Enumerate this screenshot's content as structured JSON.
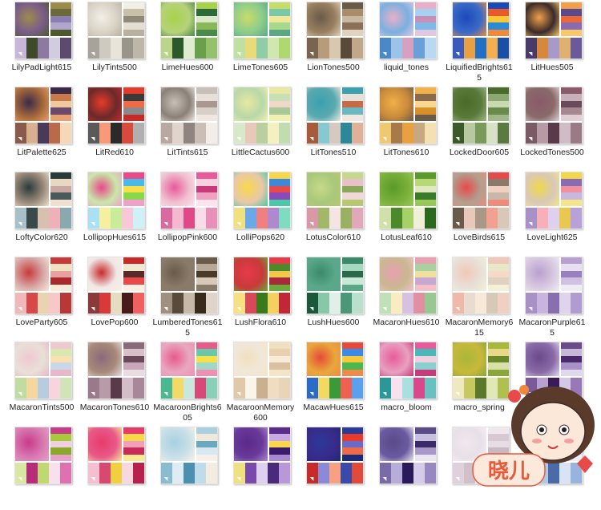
{
  "tiles": [
    {
      "label": "LilyPadLight615",
      "photo": "#7a5c8a",
      "swatches": [
        "#9c8c4c",
        "#6b6a3a",
        "#8a7db0",
        "#b0a8cc",
        "#4e5a2c",
        "#c7b6d9",
        "#3f4a2a",
        "#8c7aa0",
        "#d2cce0",
        "#5b4b6c"
      ]
    },
    {
      "label": "LilyTints500",
      "photo": "#d9d3c6",
      "swatches": [
        "#f2efe6",
        "#c8c0a8",
        "#8f8a7a",
        "#e4dfd2",
        "#b8b0a0",
        "#a8a39a",
        "#cfcac0",
        "#e8e4da",
        "#9a958a",
        "#bdb7aa"
      ]
    },
    {
      "label": "LimeHues600",
      "photo": "#b6d27a",
      "swatches": [
        "#a8d24a",
        "#2c6a3a",
        "#d8e8c8",
        "#88b858",
        "#4a8a4a",
        "#bcd48a",
        "#2a5a2a",
        "#e0ecd0",
        "#6aa04a",
        "#94c26a"
      ]
    },
    {
      "label": "LimeTones605",
      "photo": "#8ccc8c",
      "swatches": [
        "#c8dc6a",
        "#7ac8a8",
        "#f0e89a",
        "#a8d88a",
        "#5aa888",
        "#bfe0a0",
        "#e8dc7a",
        "#90cca8",
        "#d0e8b0",
        "#b0d870"
      ]
    },
    {
      "label": "LionTones500",
      "photo": "#9a8060",
      "swatches": [
        "#6a5a4a",
        "#a88c6c",
        "#c8b8a0",
        "#8a7058",
        "#e0d2bc",
        "#7a6450",
        "#b89c7a",
        "#d8c8b0",
        "#5a4a3a",
        "#c0a888"
      ]
    },
    {
      "label": "liquid_tones",
      "photo": "#7ab0e0",
      "swatches": [
        "#e8b0c8",
        "#a8d0f0",
        "#c890b8",
        "#80b8e8",
        "#e0c8e0",
        "#4a88c8",
        "#9cc4ea",
        "#d8a0c0",
        "#6aa0d8",
        "#b8d8f4"
      ]
    },
    {
      "label": "LiquifiedBrights615",
      "photo": "#3a6ac8",
      "swatches": [
        "#1a4ab8",
        "#e85a2a",
        "#f8c83a",
        "#2a8ad8",
        "#f08a3a",
        "#3a5ac0",
        "#e8a040",
        "#2070c8",
        "#f4b050",
        "#1850a8"
      ]
    },
    {
      "label": "LitHues505",
      "photo": "#3a2a2a",
      "swatches": [
        "#f0a04a",
        "#5a4a8a",
        "#e86a3a",
        "#8a6ab0",
        "#f8c86a",
        "#4a3a6a",
        "#d8883a",
        "#a89ac8",
        "#e0b070",
        "#6a5a9a"
      ]
    },
    {
      "label": "LitPalette625",
      "photo": "#a86a3a",
      "swatches": [
        "#3a2a4a",
        "#c87a4a",
        "#f0c8a0",
        "#6a4a6a",
        "#e8a070",
        "#8a5a4a",
        "#d8b090",
        "#4a3a5a",
        "#b86a4a",
        "#f4d8b8"
      ]
    },
    {
      "label": "LitRed610",
      "photo": "#6a2a2a",
      "swatches": [
        "#e83a2a",
        "#3a3a3a",
        "#f06a4a",
        "#8a8a8a",
        "#c82a2a",
        "#5a5a5a",
        "#f89a7a",
        "#2a2a2a",
        "#d84a3a",
        "#b0b0b0"
      ]
    },
    {
      "label": "LitTints615",
      "photo": "#8a8078",
      "swatches": [
        "#c8c0b8",
        "#e8e0d8",
        "#a89890",
        "#d8d0c8",
        "#f0e8e0",
        "#b8a8a0",
        "#e0d4cc",
        "#908480",
        "#cabeb6",
        "#f4ece6"
      ]
    },
    {
      "label": "LittleCactus600",
      "photo": "#b8d8a8",
      "swatches": [
        "#e8e8a0",
        "#c8e0b8",
        "#f0d8c8",
        "#a8c898",
        "#f0f0b0",
        "#d8e8c8",
        "#e8c8b8",
        "#b8d0a0",
        "#f4f0c0",
        "#c0dcb0"
      ]
    },
    {
      "label": "LitTones510",
      "photo": "#5aaab0",
      "swatches": [
        "#3aa0b0",
        "#e8e0d8",
        "#c86a4a",
        "#6ab8c0",
        "#f0e8e0",
        "#a85a3a",
        "#88c8d0",
        "#d8c8c0",
        "#2a8898",
        "#e0b098"
      ]
    },
    {
      "label": "LitTones610",
      "photo": "#c88a3a",
      "swatches": [
        "#f0b04a",
        "#8a6a4a",
        "#f8d890",
        "#d8902a",
        "#6a5a4a",
        "#f0c870",
        "#a87a4a",
        "#e8a040",
        "#c8a880",
        "#f4e0b0"
      ]
    },
    {
      "label": "LockedDoor605",
      "photo": "#5a7a3a",
      "swatches": [
        "#4a6a2a",
        "#8aa870",
        "#c8d8b0",
        "#6a8a4a",
        "#a0b888",
        "#3a5a2a",
        "#b8c8a0",
        "#7a9a5a",
        "#d8e0c8",
        "#5a7a40"
      ]
    },
    {
      "label": "LockedTones500",
      "photo": "#8a6a6a",
      "swatches": [
        "#8a5a6a",
        "#c8b0b8",
        "#6a4a5a",
        "#a88890",
        "#e0d0d4",
        "#7a5a64",
        "#b89aa4",
        "#5a3a4a",
        "#d0bcc4",
        "#9a7a84"
      ]
    },
    {
      "label": "LoftyColor620",
      "photo": "#9a8a7a",
      "swatches": [
        "#2a3a3a",
        "#e8d8c0",
        "#c8a8a0",
        "#4a5a5a",
        "#f0e0d0",
        "#a8c0c8",
        "#3a4a4a",
        "#d8c0b0",
        "#f0b0b8",
        "#8aa8b0"
      ]
    },
    {
      "label": "LollipopHues615",
      "photo": "#c8e8a8",
      "swatches": [
        "#e84a8a",
        "#4ab8e8",
        "#f8e04a",
        "#8ad84a",
        "#f0a0c8",
        "#a8e0f4",
        "#f4f0a0",
        "#c8ec98",
        "#f8c8d8",
        "#d0f0f8"
      ]
    },
    {
      "label": "LollipopPink600",
      "photo": "#f0c0d0",
      "swatches": [
        "#e85a9a",
        "#f8d0e0",
        "#c83a7a",
        "#f0a0c0",
        "#fbe4ec",
        "#d86aa0",
        "#f4b8d0",
        "#e04888",
        "#f8dce8",
        "#e890b8"
      ]
    },
    {
      "label": "LolliPops620",
      "photo": "#e8c8a8",
      "swatches": [
        "#f8d84a",
        "#3a8ad8",
        "#e84a4a",
        "#8a4ab8",
        "#4ac8a8",
        "#f0e080",
        "#6aa8e8",
        "#f08080",
        "#b088d0",
        "#80dcc0"
      ]
    },
    {
      "label": "LotusColor610",
      "photo": "#a8c87a",
      "swatches": [
        "#c8d88a",
        "#e8c0c8",
        "#8aa85a",
        "#f0d8d8",
        "#b8c870",
        "#d898a8",
        "#a0b868",
        "#f4e4e4",
        "#98b060",
        "#e0a8b8"
      ]
    },
    {
      "label": "LotusLeaf610",
      "photo": "#7ab03a",
      "swatches": [
        "#5a9a2a",
        "#b8d878",
        "#e0e8c0",
        "#3a7a2a",
        "#98c858",
        "#d0e0a8",
        "#4a8a2a",
        "#a8d068",
        "#f0f0d8",
        "#2a6a1a"
      ]
    },
    {
      "label": "LoveBirds615",
      "photo": "#b0a090",
      "swatches": [
        "#e84a4a",
        "#8a7a6a",
        "#f0d0c0",
        "#c8b8a8",
        "#f08a7a",
        "#6a5a4a",
        "#e8c8b8",
        "#a89888",
        "#f4a090",
        "#d8c8b8"
      ]
    },
    {
      "label": "LoveLight625",
      "photo": "#d8c8b8",
      "swatches": [
        "#f0d84a",
        "#8a6ab0",
        "#f090a0",
        "#c8b8e0",
        "#f4e48a",
        "#a890c8",
        "#f8b0b8",
        "#e0d0f0",
        "#e8c850",
        "#b8a0d8"
      ]
    },
    {
      "label": "LoveParty605",
      "photo": "#d8a8a8",
      "swatches": [
        "#c83a3a",
        "#f0e0c0",
        "#e8a0a0",
        "#a82a2a",
        "#f4ecd8",
        "#f0b8b8",
        "#d84848",
        "#e8d4b0",
        "#f8c8c8",
        "#b83838"
      ]
    },
    {
      "label": "LovePop600",
      "photo": "#f0e8e8",
      "swatches": [
        "#c82a2a",
        "#f0e8d0",
        "#5a2a2a",
        "#e84a4a",
        "#f8f0e0",
        "#8a3a3a",
        "#d83a3a",
        "#e8dcc0",
        "#4a1a1a",
        "#f06060"
      ]
    },
    {
      "label": "LumberedTones615",
      "photo": "#8a7a6a",
      "swatches": [
        "#6a5a4a",
        "#b8a898",
        "#4a3a2a",
        "#d8c8b8",
        "#8a7a6a",
        "#a09080",
        "#5a4a3a",
        "#c8b8a8",
        "#3a2a1a",
        "#e0d4c8"
      ]
    },
    {
      "label": "LushFlora610",
      "photo": "#c83a3a",
      "swatches": [
        "#e83a4a",
        "#4a8a2a",
        "#f0c84a",
        "#a82a3a",
        "#6aaa3a",
        "#f8e080",
        "#d84858",
        "#3a7a1a",
        "#f4d060",
        "#c02838"
      ]
    },
    {
      "label": "LushHues600",
      "photo": "#5aa88a",
      "swatches": [
        "#3a8a6a",
        "#a8d8c0",
        "#2a6a4a",
        "#c8e8d8",
        "#5aa888",
        "#1a5a3a",
        "#88c8a8",
        "#e0f0e8",
        "#4a9878",
        "#b8e0cc"
      ]
    },
    {
      "label": "MacaronHues610",
      "photo": "#c8b890",
      "swatches": [
        "#e8a0b0",
        "#a8d0a0",
        "#f0e0a0",
        "#c8a8d0",
        "#f4c0c8",
        "#c0e0b8",
        "#f8ecc0",
        "#d8c0e0",
        "#e090a0",
        "#98c890"
      ]
    },
    {
      "label": "MacaronMemory615",
      "photo": "#e8e0d8",
      "swatches": [
        "#f0c8b8",
        "#e8e8c8",
        "#f8d8c8",
        "#e0d0c0",
        "#f4f0d8",
        "#f0b8a8",
        "#e8dcd0",
        "#f8e8d8",
        "#d8c8b8",
        "#f0d0c0"
      ]
    },
    {
      "label": "MacaronPurple615",
      "photo": "#d8c8e0",
      "swatches": [
        "#b8a0d0",
        "#e8e0f0",
        "#9880c0",
        "#d0c0e4",
        "#f0ecf6",
        "#a890c8",
        "#c8b4dc",
        "#8870b0",
        "#e0d4ec",
        "#b09cd0"
      ]
    },
    {
      "label": "MacaronTints500",
      "photo": "#e8e0d8",
      "swatches": [
        "#f0c8d0",
        "#d8e8b0",
        "#f8e0b0",
        "#c8d8e8",
        "#e8b8c8",
        "#c0dca0",
        "#f4d8a0",
        "#b8cce0",
        "#f8d4dc",
        "#d0e4b8"
      ]
    },
    {
      "label": "MacaronTones610",
      "photo": "#a88a7a",
      "swatches": [
        "#8a6a7a",
        "#d8c0c8",
        "#6a4a5a",
        "#c8a8b8",
        "#e8dce0",
        "#9a7a8a",
        "#b89aa8",
        "#5a3a4a",
        "#d4bcc8",
        "#a88898"
      ]
    },
    {
      "label": "MacaroonBrights605",
      "photo": "#e8a8c0",
      "swatches": [
        "#e85a8a",
        "#6ac8a8",
        "#f8e04a",
        "#a0d8c8",
        "#f090b0",
        "#4ab890",
        "#f4d868",
        "#c8e8dc",
        "#d84878",
        "#88d0b8"
      ]
    },
    {
      "label": "MacaroonMemory600",
      "photo": "#f0e8d8",
      "swatches": [
        "#f0e0c0",
        "#e8d0b0",
        "#f8ecd8",
        "#d8c0a0",
        "#f4e4c8",
        "#e0c8a8",
        "#fbf4e8",
        "#c8b090",
        "#f0dcc0",
        "#e8d4b8"
      ]
    },
    {
      "label": "MacawHues615",
      "photo": "#e8a83a",
      "swatches": [
        "#e84a3a",
        "#3a8ae8",
        "#f8c83a",
        "#4ab84a",
        "#f08a4a",
        "#2a6ac8",
        "#f4d860",
        "#3a9a3a",
        "#f06050",
        "#5aa0f0"
      ]
    },
    {
      "label": "macro_bloom",
      "photo": "#e8a0c0",
      "swatches": [
        "#e85a9a",
        "#4ab8b8",
        "#f0d0e0",
        "#8ad0d0",
        "#c83a7a",
        "#2a9898",
        "#f8e0ec",
        "#a8e0e0",
        "#d8488a",
        "#68c0c0"
      ]
    },
    {
      "label": "macro_spring",
      "photo": "#c8b83a",
      "swatches": [
        "#a8b83a",
        "#e8d88a",
        "#6a8a2a",
        "#d8e0a8",
        "#8aa83a",
        "#f0e8c0",
        "#c8c860",
        "#5a7a2a",
        "#e0e8b8",
        "#b0c050"
      ]
    },
    {
      "label": "",
      "photo": "#8a6aa8",
      "swatches": [
        "#6a4a8a",
        "#c8b8d8",
        "#4a2a6a",
        "#a890c8",
        "#e0d8ec",
        "#7a5a9a",
        "#b8a0d0",
        "#3a1a5a",
        "#d4c8e4",
        "#9878b8"
      ]
    },
    {
      "label": "",
      "photo": "#d87ab0",
      "swatches": [
        "#c83a8a",
        "#a8c83a",
        "#f0d0e0",
        "#8aa82a",
        "#e8a0c8",
        "#d8e8a0",
        "#b82a7a",
        "#c0d870",
        "#f8e0ec",
        "#e070b0"
      ]
    },
    {
      "label": "",
      "photo": "#e85a8a",
      "swatches": [
        "#e83a6a",
        "#f8d84a",
        "#f0a0b8",
        "#c82a5a",
        "#f8e890",
        "#f4c0d0",
        "#d84870",
        "#f0d040",
        "#f8d8e0",
        "#b82050"
      ]
    },
    {
      "label": "",
      "photo": "#c8e0e8",
      "swatches": [
        "#a8d0e0",
        "#f0e8d8",
        "#6aa8c0",
        "#d8e8f0",
        "#f8f0e8",
        "#88bcd0",
        "#e0ecf4",
        "#4a90b0",
        "#c0dcea",
        "#f4ece0"
      ]
    },
    {
      "label": "",
      "photo": "#6a3a9a",
      "swatches": [
        "#5a2a8a",
        "#c8a8e0",
        "#f8d84a",
        "#3a1a6a",
        "#a888d0",
        "#f0e080",
        "#7a4aaa",
        "#e0d0f0",
        "#4a2a7a",
        "#b898d8"
      ]
    },
    {
      "label": "",
      "photo": "#3a2a8a",
      "swatches": [
        "#2a3a9a",
        "#e83a2a",
        "#6a6ac8",
        "#f06a4a",
        "#1a2a7a",
        "#c82a2a",
        "#8a8ad8",
        "#f8a080",
        "#3a4aaa",
        "#e04a3a"
      ]
    },
    {
      "label": "",
      "photo": "#6a5aa0",
      "swatches": [
        "#5a4a8a",
        "#c8c0e0",
        "#3a2a6a",
        "#a898c8",
        "#e8e4f0",
        "#7a6aa8",
        "#b8acd8",
        "#2a1a5a",
        "#d4cce8",
        "#9888c0"
      ]
    },
    {
      "label": "",
      "photo": "#e8e0e8",
      "swatches": [
        "#f0e8ec",
        "#d8c8d4",
        "#e8dce4",
        "#c8b8c4",
        "#f8f0f4",
        "#e0d0dc",
        "#d0c0cc",
        "#f4ecf0",
        "#c0b0bc",
        "#e8e0e6"
      ]
    },
    {
      "label": "",
      "photo": "#a8c0e0",
      "swatches": [
        "#88a8d8",
        "#e8e0f0",
        "#5a7ab8",
        "#c8d8ec",
        "#f0ecf8",
        "#7898cc",
        "#b0c8e8",
        "#4a6aa8",
        "#d8e4f4",
        "#98b4dc"
      ]
    }
  ],
  "sticker": {
    "text": "晓儿"
  }
}
